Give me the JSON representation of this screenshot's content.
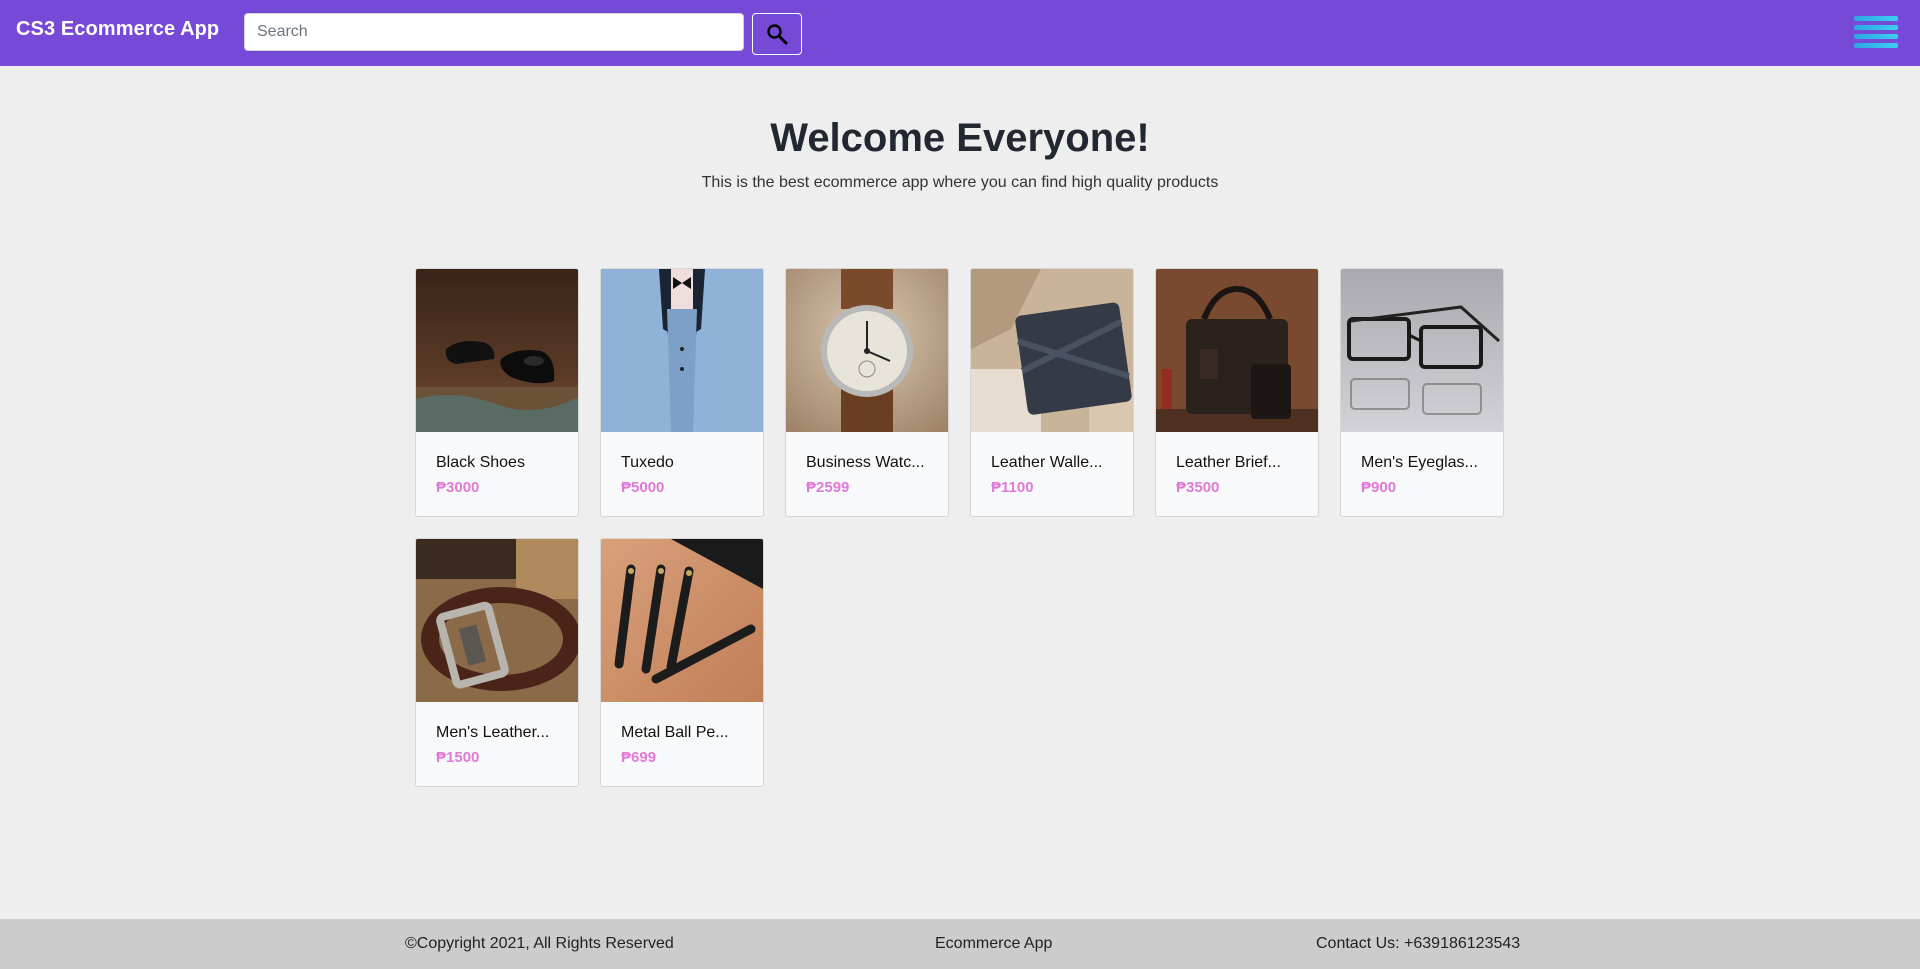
{
  "navbar": {
    "brand": "CS3 Ecommerce App",
    "search_placeholder": "Search",
    "search_icon": "search-icon",
    "menu_icon": "hamburger-menu-icon",
    "color": "#7649d6"
  },
  "hero": {
    "title": "Welcome Everyone!",
    "subtitle": "This is the best ecommerce app where you can find high quality products"
  },
  "products": [
    {
      "name": "Black Shoes",
      "price": "₱3000",
      "image": "black-shoes-image"
    },
    {
      "name": "Tuxedo",
      "price": "₱5000",
      "image": "tuxedo-image"
    },
    {
      "name": "Business Watc...",
      "price": "₱2599",
      "image": "business-watch-image"
    },
    {
      "name": "Leather Walle...",
      "price": "₱1100",
      "image": "leather-wallet-image"
    },
    {
      "name": "Leather Brief...",
      "price": "₱3500",
      "image": "leather-briefcase-image"
    },
    {
      "name": "Men's Eyeglas...",
      "price": "₱900",
      "image": "eyeglasses-image"
    },
    {
      "name": "Men's Leather...",
      "price": "₱1500",
      "image": "leather-belt-image"
    },
    {
      "name": "Metal Ball Pe...",
      "price": "₱699",
      "image": "ball-pens-image"
    }
  ],
  "footer": {
    "copyright": "©Copyright 2021, All Rights Reserved",
    "app_name": "Ecommerce App",
    "contact": "Contact Us: +639186123543"
  },
  "colors": {
    "price": "#e07ad6",
    "background": "#eeeeee",
    "footer": "#cccccc"
  }
}
